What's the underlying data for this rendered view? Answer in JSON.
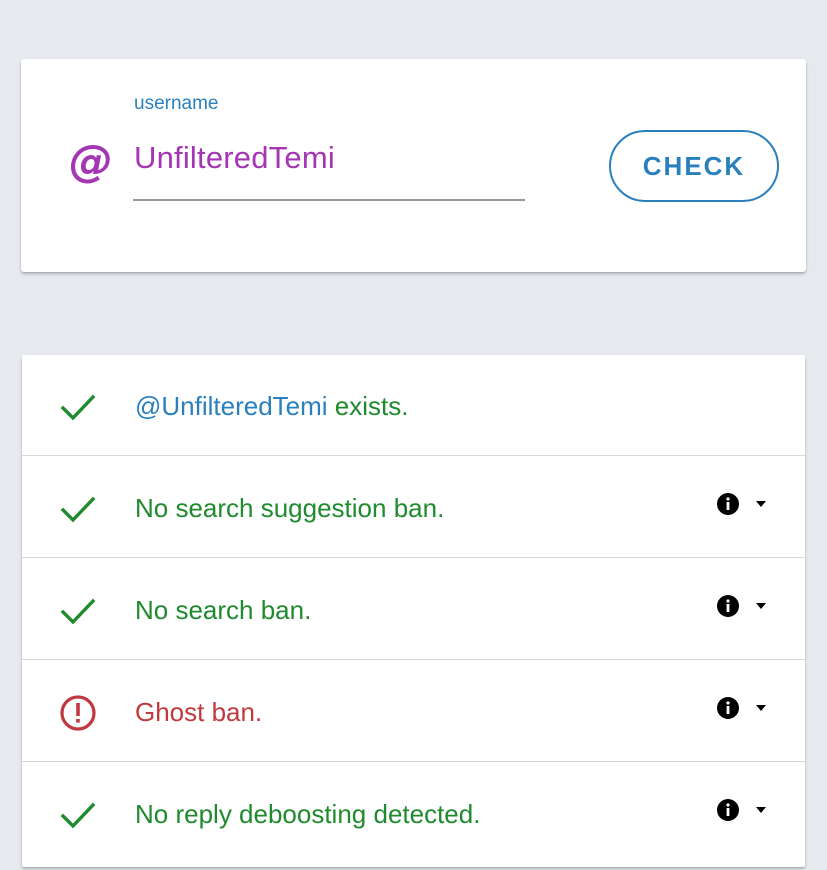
{
  "form": {
    "field_label": "username",
    "at_symbol": "@",
    "username_value": "UnfilteredTemi",
    "check_button_label": "CHECK"
  },
  "results": [
    {
      "status": "ok",
      "icon": "check-icon",
      "handle": "@UnfilteredTemi",
      "text": " exists.",
      "has_details": false
    },
    {
      "status": "ok",
      "icon": "check-icon",
      "text": "No search suggestion ban.",
      "has_details": true
    },
    {
      "status": "ok",
      "icon": "check-icon",
      "text": "No search ban.",
      "has_details": true
    },
    {
      "status": "ban",
      "icon": "alert-circle-icon",
      "text": "Ghost ban.",
      "has_details": true
    },
    {
      "status": "ok",
      "icon": "check-icon",
      "text": "No reply deboosting detected.",
      "has_details": true
    }
  ],
  "colors": {
    "background": "#e6eaee",
    "accent_blue": "#2a80bd",
    "username_purple": "#a436b4",
    "ok_green": "#1f8a2e",
    "ban_red": "#c0393f"
  }
}
